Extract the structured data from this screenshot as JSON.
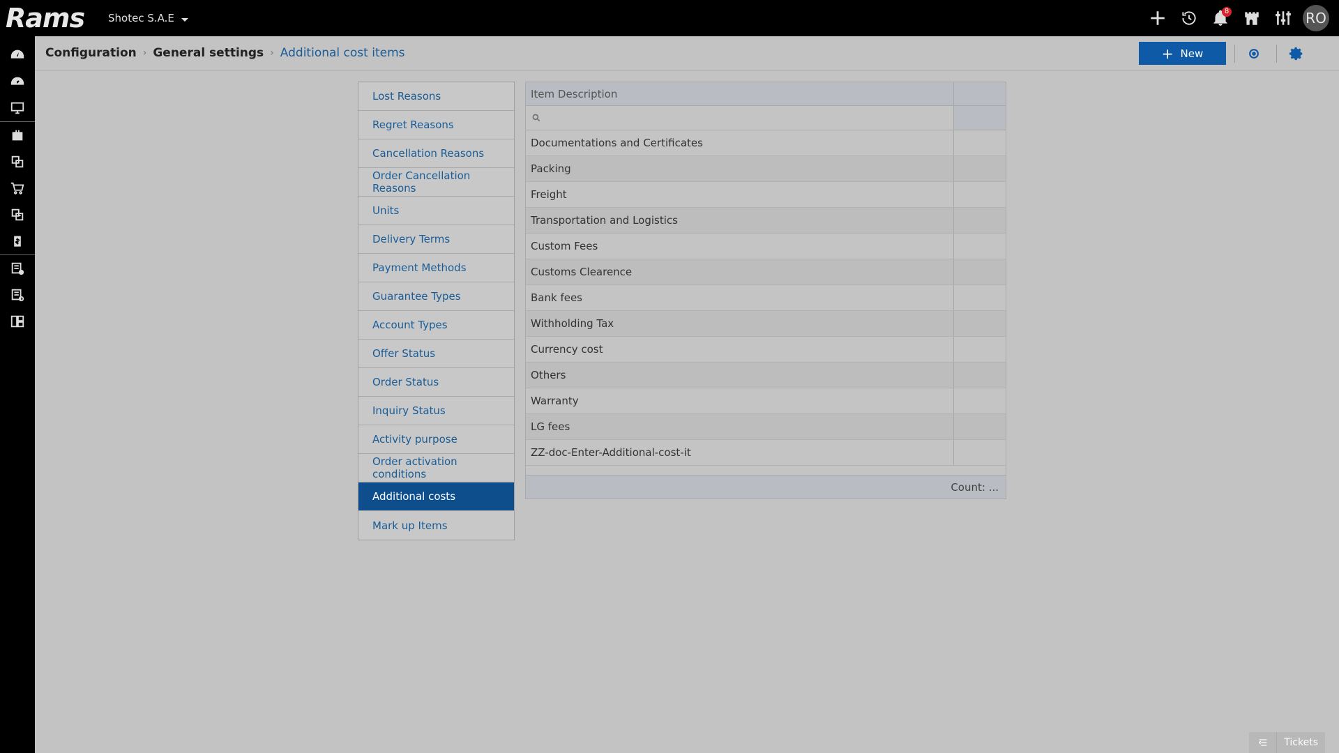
{
  "app": {
    "logo_text": "Rams",
    "company": "Shotec S.A.E"
  },
  "topbar": {
    "notification_count": "8",
    "avatar_initials": "RO"
  },
  "breadcrumb": {
    "items": [
      "Configuration",
      "General settings"
    ],
    "current": "Additional cost items"
  },
  "toolbar": {
    "new_label": "New"
  },
  "sidemenu": {
    "items": [
      "Lost Reasons",
      "Regret Reasons",
      "Cancellation Reasons",
      "Order Cancellation Reasons",
      "Units",
      "Delivery Terms",
      "Payment Methods",
      "Guarantee Types",
      "Account Types",
      "Offer Status",
      "Order Status",
      "Inquiry Status",
      "Activity purpose",
      "Order activation conditions",
      "Additional costs",
      "Mark up Items"
    ],
    "active": "Additional costs"
  },
  "grid": {
    "column_header": "Item Description",
    "filter_placeholder": "",
    "rows": [
      "Documentations and Certificates",
      "Packing",
      "Freight",
      "Transportation and Logistics",
      "Custom Fees",
      "Customs Clearence",
      "Bank fees",
      "Withholding Tax",
      "Currency cost",
      "Others",
      "Warranty",
      "LG fees",
      "ZZ-doc-Enter-Additional-cost-it"
    ],
    "footer_count": "Count: ..."
  },
  "tickets": {
    "label": "Tickets"
  },
  "colors": {
    "accent": "#0e5aa7",
    "active_menu": "#0f4e8c",
    "link": "#1a5c96",
    "badge": "#d9232d"
  }
}
